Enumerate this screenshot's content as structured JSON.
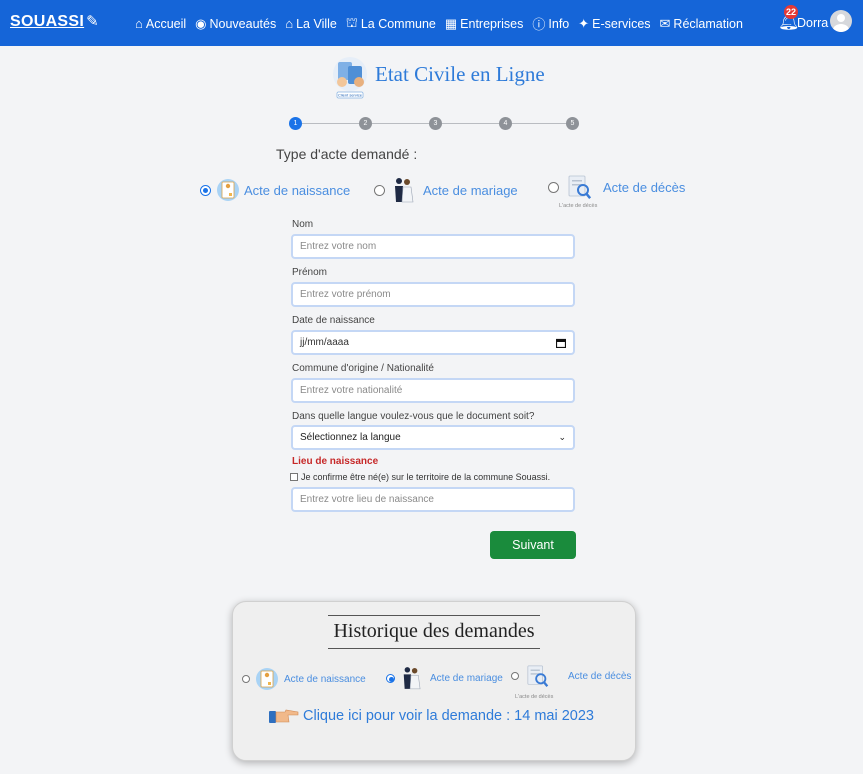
{
  "navbar": {
    "brand": "SOUASSI",
    "items": [
      {
        "label": "Accueil",
        "icon": "home-icon"
      },
      {
        "label": "Nouveautés",
        "icon": "globe-icon"
      },
      {
        "label": "La Ville",
        "icon": "city-icon"
      },
      {
        "label": "La Commune",
        "icon": "institution-icon"
      },
      {
        "label": "Entreprises",
        "icon": "building-icon"
      },
      {
        "label": "Info",
        "icon": "info-icon"
      },
      {
        "label": "E-services",
        "icon": "sparkle-icon"
      },
      {
        "label": "Réclamation",
        "icon": "mail-icon"
      }
    ],
    "notification_count": "22",
    "user_name": "Dorra",
    "color": "#1565d8"
  },
  "header": {
    "title": "Etat Civile en Ligne",
    "logo_caption": "Client service"
  },
  "stepper": {
    "steps": [
      "1",
      "2",
      "3",
      "4",
      "5"
    ],
    "current": 1
  },
  "act_type": {
    "label": "Type d'acte demandé :",
    "options": [
      {
        "label": "Acte de naissance",
        "checked": true
      },
      {
        "label": "Acte de mariage",
        "checked": false
      },
      {
        "label": "Acte de décès",
        "checked": false,
        "caption": "L'acte de décès"
      }
    ]
  },
  "form": {
    "nom_label": "Nom",
    "nom_placeholder": "Entrez votre nom",
    "prenom_label": "Prénom",
    "prenom_placeholder": "Entrez votre prénom",
    "date_label": "Date de naissance",
    "date_value": "jj/mm/aaaa",
    "nationalite_label": "Commune d'origine / Nationalité",
    "nationalite_placeholder": "Entrez votre nationalité",
    "langue_label": "Dans quelle langue voulez-vous que le document soit?",
    "langue_value": "Sélectionnez la langue",
    "lieu_title": "Lieu de naissance",
    "confirm_text": "Je confirme être né(e) sur le territoire de la commune Souassi.",
    "lieu_placeholder": "Entrez votre lieu de naissance",
    "submit_label": "Suivant"
  },
  "history": {
    "title": "Historique des demandes",
    "options": [
      {
        "label": "Acte de naissance",
        "checked": false
      },
      {
        "label": "Acte de mariage",
        "checked": true
      },
      {
        "label": "Acte de décès",
        "checked": false,
        "caption": "L'acte de décès"
      }
    ],
    "link_text": "Clique ici pour voir la demande : 14 mai 2023"
  }
}
